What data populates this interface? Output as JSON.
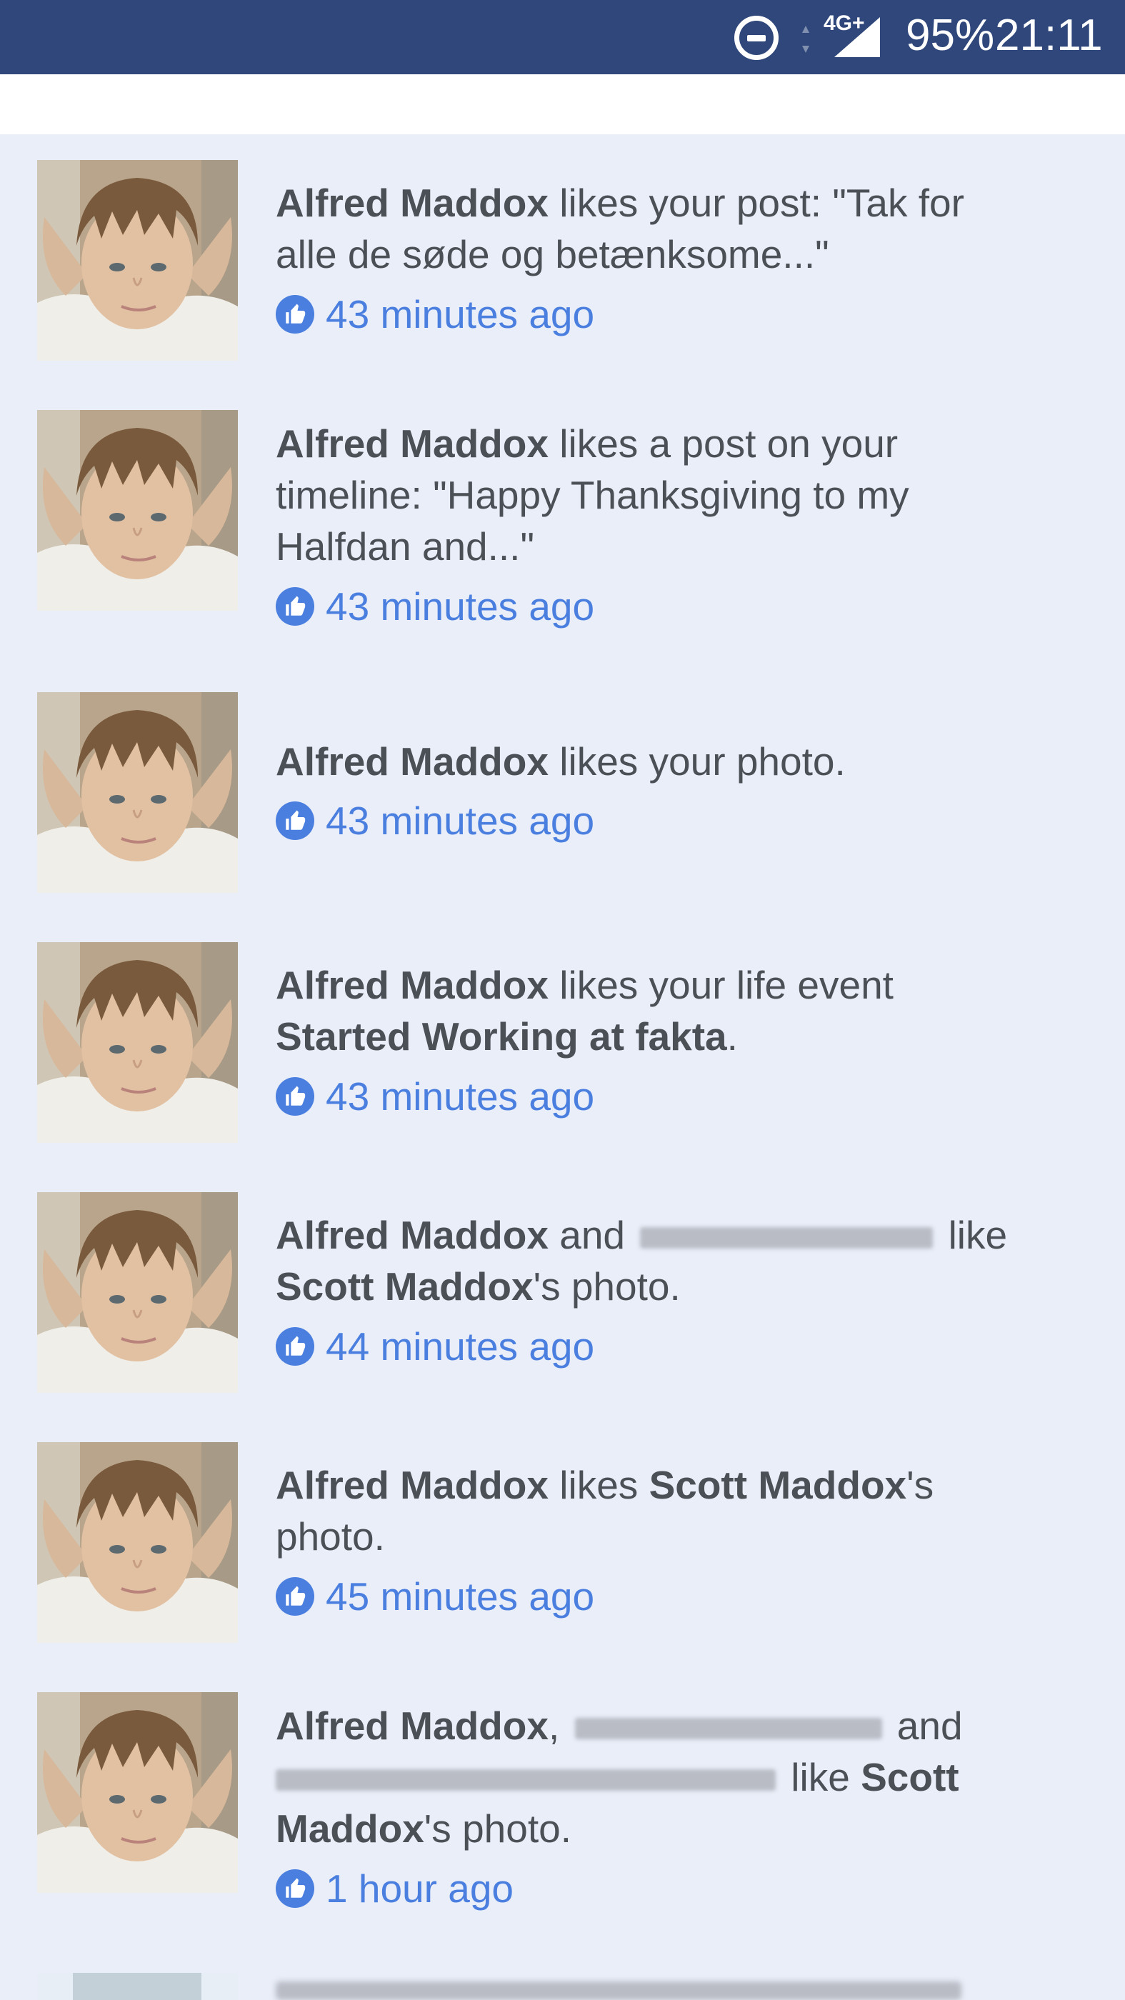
{
  "status_bar": {
    "network": "4G+",
    "battery": "95%",
    "time": "21:11",
    "icons": [
      "do-not-disturb-icon",
      "data-arrows-icon",
      "signal-icon"
    ]
  },
  "colors": {
    "status_bar_bg": "#2f477a",
    "feed_bg": "#e9eef8",
    "text": "#4b4f56",
    "timestamp_blue": "#4a7fe0"
  },
  "notifications": [
    {
      "actor": "Alfred Maddox",
      "text_1": " likes your post: \"Tak for",
      "text_2": "alle de søde og betænksome...\"",
      "time": "43 minutes ago",
      "icon": "thumbs-up-icon"
    },
    {
      "actor": "Alfred Maddox",
      "text_1": " likes a post on your",
      "text_2": "timeline: \"Happy Thanksgiving to my",
      "text_3": "Halfdan and...\"",
      "time": "43 minutes ago",
      "icon": "thumbs-up-icon"
    },
    {
      "actor": "Alfred Maddox",
      "text_1": " likes your photo.",
      "time": "43 minutes ago",
      "icon": "thumbs-up-icon"
    },
    {
      "actor": "Alfred Maddox",
      "text_1": " likes your life event",
      "bold_2": "Started Working at fakta",
      "text_2": ".",
      "time": "43 minutes ago",
      "icon": "thumbs-up-icon"
    },
    {
      "actor": "Alfred Maddox",
      "text_1": " and ",
      "text_1b": " like",
      "bold_2": "Scott Maddox",
      "text_2": "'s photo.",
      "time": "44 minutes ago",
      "icon": "thumbs-up-icon"
    },
    {
      "actor": "Alfred Maddox",
      "text_1": " likes ",
      "bold_1b": "Scott Maddox",
      "text_1c": "'s",
      "text_2": "photo.",
      "time": "45 minutes ago",
      "icon": "thumbs-up-icon"
    },
    {
      "actor": "Alfred Maddox",
      "text_1": ", ",
      "text_1b": " and",
      "text_2": " like ",
      "bold_2b": "Scott",
      "bold_3": "Maddox",
      "text_3": "'s photo.",
      "time": "1 hour ago",
      "icon": "thumbs-up-icon"
    }
  ]
}
